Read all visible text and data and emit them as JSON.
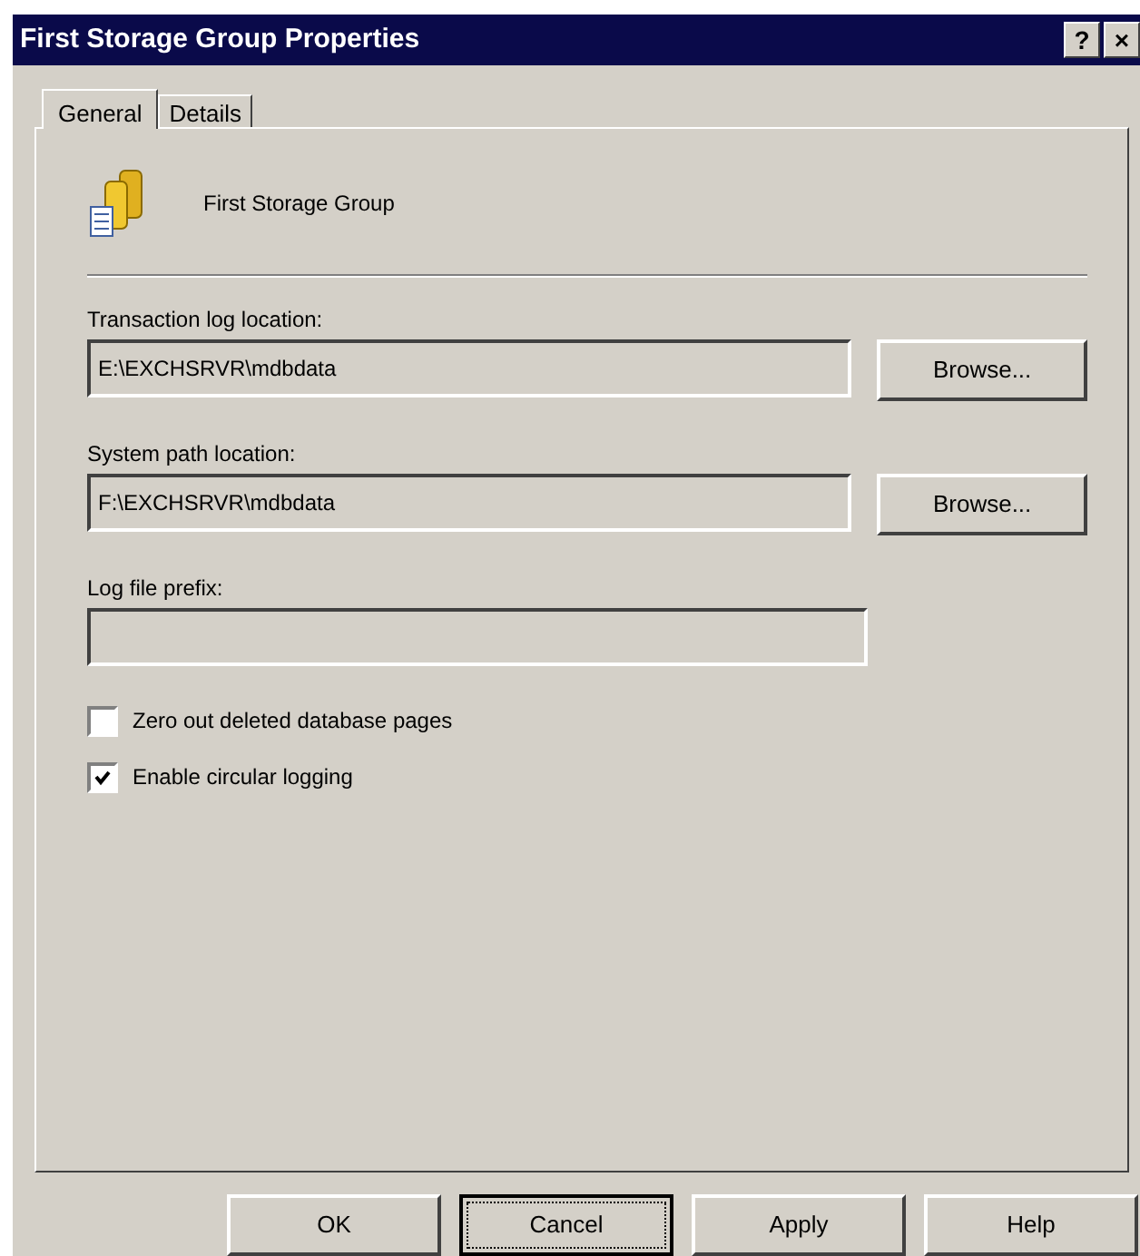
{
  "window": {
    "title": "First Storage Group Properties",
    "buttons": [
      "?",
      "×"
    ]
  },
  "tabs": [
    {
      "label": "General",
      "selected": true
    },
    {
      "label": "Details",
      "selected": false
    }
  ],
  "header": {
    "name": "First Storage Group"
  },
  "fields": [
    {
      "label": "Transaction log location:",
      "value": "E:\\EXCHSRVR\\mdbdata",
      "button": "Browse..."
    },
    {
      "label": "System path location:",
      "value": "F:\\EXCHSRVR\\mdbdata",
      "button": "Browse..."
    },
    {
      "label": "Log file prefix:"
    }
  ],
  "checkboxes": [
    {
      "label": "Zero out deleted database pages",
      "checked": false
    },
    {
      "label": "Enable circular logging",
      "checked": true
    }
  ],
  "buttons": [
    {
      "label": "OK",
      "focused": false
    },
    {
      "label": "Cancel",
      "focused": true
    },
    {
      "label": "Apply",
      "focused": false
    },
    {
      "label": "Help",
      "focused": false
    }
  ]
}
